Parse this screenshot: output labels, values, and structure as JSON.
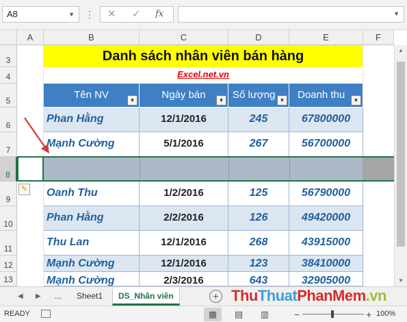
{
  "formula_bar": {
    "name_box": "A8",
    "formula": ""
  },
  "columns": [
    "A",
    "B",
    "C",
    "D",
    "E",
    "F"
  ],
  "rows": [
    "3",
    "4",
    "5",
    "6",
    "7",
    "8",
    "9",
    "10",
    "11",
    "12",
    "13"
  ],
  "sheet": {
    "title": "Danh sách nhân viên bán hàng",
    "subtitle": "Excel.net.vn",
    "headers": [
      "Tên NV",
      "Ngày bán",
      "Số lượng",
      "Doanh thu"
    ],
    "data_rows": [
      [
        "Phan Hằng",
        "12/1/2016",
        "245",
        "67800000"
      ],
      [
        "Mạnh Cường",
        "5/1/2016",
        "267",
        "56700000"
      ],
      [
        "",
        "",
        "",
        ""
      ],
      [
        "Oanh Thu",
        "1/2/2016",
        "125",
        "56790000"
      ],
      [
        "Phan Hằng",
        "2/2/2016",
        "126",
        "49420000"
      ],
      [
        "Thu Lan",
        "12/1/2016",
        "268",
        "43915000"
      ],
      [
        "Mạnh Cường",
        "12/1/2016",
        "123",
        "38410000"
      ],
      [
        "Mạnh Cường",
        "2/3/2016",
        "643",
        "32905000"
      ]
    ]
  },
  "tabs": {
    "ellipsis": "...",
    "sheets": [
      "Sheet1",
      "DS_Nhân viên"
    ],
    "active": "DS_Nhân viên"
  },
  "watermark": {
    "part1": "Thu",
    "part2": "Thuat",
    "part3": "PhanMem",
    "part4": ".vn"
  },
  "status": {
    "ready": "READY",
    "zoom": "100%"
  },
  "colors": {
    "header_blue": "#3f7fc3",
    "title_yellow": "#ffff00",
    "excel_green": "#217346",
    "band_light": "#dce6f1"
  }
}
